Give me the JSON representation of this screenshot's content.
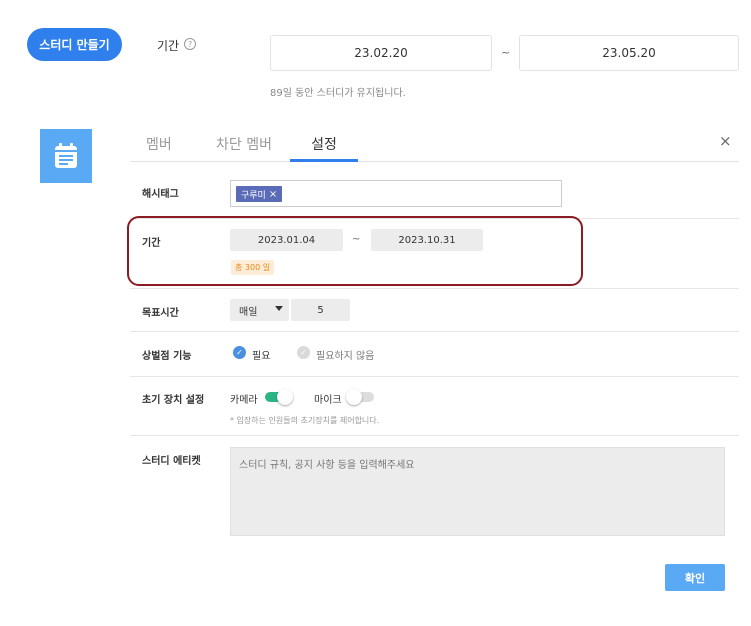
{
  "header": {
    "create_button": "스터디 만들기",
    "period_label": "기간",
    "help_icon": "question-circle",
    "start_date": "23.02.20",
    "end_date": "23.05.20",
    "tilde": "~",
    "duration_text": "89일 동안 스터디가 유지됩니다."
  },
  "sidebar": {
    "tile_icon": "calendar-icon",
    "tile_color": "#5aa9f5"
  },
  "tabs": [
    {
      "label": "멤버"
    },
    {
      "label": "차단 멤버"
    },
    {
      "label": "설정"
    }
  ],
  "active_tab": "설정",
  "close_symbol": "×",
  "settings": {
    "hashtag": {
      "label": "해시태그",
      "tags": [
        "구루미"
      ],
      "remove_symbol": "×"
    },
    "period": {
      "label": "기간",
      "start": "2023.01.04",
      "end": "2023.10.31",
      "tilde": "~",
      "total": "총 300 일"
    },
    "goal_time": {
      "label": "목표시간",
      "frequency": "매일",
      "value": "5"
    },
    "reward": {
      "label": "상벌점 기능",
      "options": [
        "필요",
        "필요하지 않음"
      ],
      "selected": "필요",
      "check_symbol": "✓"
    },
    "device": {
      "label": "초기 장치 설정",
      "camera_label": "카메라",
      "camera_on": true,
      "mic_label": "마이크",
      "mic_on": false,
      "note": "* 입장하는 인원들의 초기장치를 제어합니다."
    },
    "etiquette": {
      "label": "스터디 에티켓",
      "placeholder": "스터디 규칙, 공지 사항 등을 입력해주세요"
    }
  },
  "confirm_button": "확인",
  "colors": {
    "primary": "#2f80ed",
    "highlight": "#8b1c24",
    "toggle_on": "#2bb585",
    "badge_text": "#e98a15"
  }
}
